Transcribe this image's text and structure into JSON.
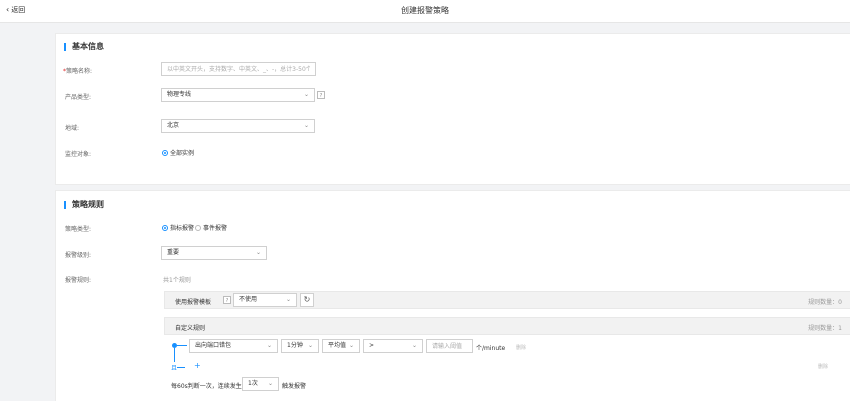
{
  "header": {
    "back_label": "返回",
    "title": "创建报警策略"
  },
  "basic": {
    "section_title": "基本信息",
    "name_label": "策略名称:",
    "name_required_mark": "*",
    "name_placeholder": "以中英文开头，支持数字、中英文、_、-，总计3-50个字",
    "product_label": "产品类型:",
    "product_value": "物理专线",
    "help_icon_text": "?",
    "region_label": "地域:",
    "region_value": "北京",
    "target_label": "监控对象:",
    "target_option": "全部实例"
  },
  "rules": {
    "section_title": "策略规则",
    "policy_type_label": "策略类型:",
    "policy_type_opt1": "指标报警",
    "policy_type_opt2": "事件报警",
    "level_label": "报警级别:",
    "level_value": "重要",
    "rule_label": "报警规则:",
    "rule_count_text": "共1个规则",
    "template_label": "使用报警模板",
    "template_value": "不使用",
    "template_rule_count": "规则数量：0",
    "custom_title": "自定义规则",
    "custom_rule_count": "规则数量：1",
    "condition": {
      "metric": "出向端口错包",
      "period": "1分钟",
      "stat": "平均值",
      "operator": ">",
      "threshold_placeholder": "请输入阈值",
      "unit": "个/minute",
      "tail_note": "删除"
    },
    "and_label": "且",
    "delete_label": "删除",
    "freq_prefix": "每60s判断一次，连续发生",
    "freq_value": "1次",
    "freq_suffix": "触发报警"
  }
}
